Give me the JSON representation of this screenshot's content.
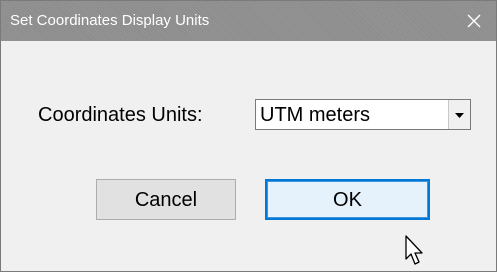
{
  "window": {
    "title": "Set Coordinates Display Units",
    "close_icon": "close-icon"
  },
  "form": {
    "units_label": "Coordinates Units:",
    "units_select": {
      "selected": "UTM meters",
      "arrow_icon": "dropdown-arrow-icon"
    }
  },
  "buttons": {
    "cancel_label": "Cancel",
    "ok_label": "OK"
  },
  "pointer_icon": "mouse-pointer-icon",
  "colors": {
    "focus_border": "#0078d7",
    "button_face": "#e1e1e1",
    "dialog_background": "#f0f0f0"
  }
}
